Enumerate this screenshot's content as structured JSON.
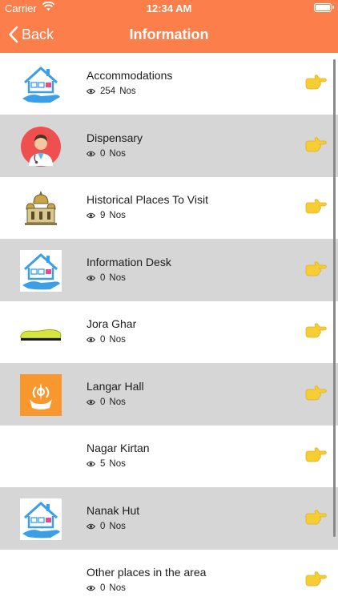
{
  "status": {
    "carrier": "Carrier",
    "time": "12:34 AM"
  },
  "nav": {
    "back_label": "Back",
    "title": "Information"
  },
  "colors": {
    "header": "#fb7e4b",
    "shaded_row": "#d6d6d6",
    "hand": "#f6cd33",
    "icon_blue": "#3a9ee8",
    "langar_tile": "#f7972d"
  },
  "items": [
    {
      "label": "Accommodations",
      "count": "254",
      "unit": "Nos",
      "icon": "house-hand-icon"
    },
    {
      "label": "Dispensary",
      "count": "0",
      "unit": "Nos",
      "icon": "doctor-icon"
    },
    {
      "label": "Historical Places To Visit",
      "count": "9",
      "unit": "Nos",
      "icon": "gurdwara-icon"
    },
    {
      "label": "Information Desk",
      "count": "0",
      "unit": "Nos",
      "icon": "house-hand-icon"
    },
    {
      "label": "Jora Ghar",
      "count": "0",
      "unit": "Nos",
      "icon": "shoe-icon"
    },
    {
      "label": "Langar Hall",
      "count": "0",
      "unit": "Nos",
      "icon": "khanda-hands-icon"
    },
    {
      "label": "Nagar Kirtan",
      "count": "5",
      "unit": "Nos",
      "icon": ""
    },
    {
      "label": "Nanak Hut",
      "count": "0",
      "unit": "Nos",
      "icon": "house-hand-icon"
    },
    {
      "label": "Other places in the area",
      "count": "0",
      "unit": "Nos",
      "icon": ""
    }
  ]
}
